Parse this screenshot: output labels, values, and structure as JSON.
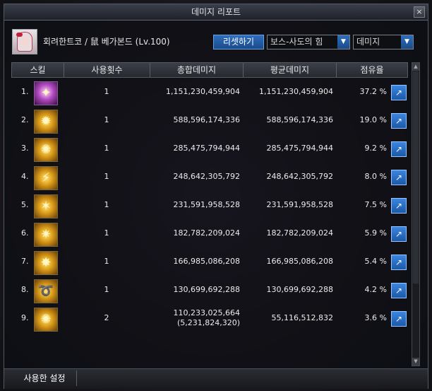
{
  "window": {
    "title": "데미지 리포트",
    "close_label": "×"
  },
  "character": {
    "info": "회려한트코 / 鼠 베가본드 (Lv.100)"
  },
  "toolbar": {
    "reset_label": "리셋하기",
    "dungeon_select": "보스-사도의 힘",
    "type_select": "데미지"
  },
  "table": {
    "headers": [
      "스킬",
      "사용횟수",
      "총합데미지",
      "평균데미지",
      "점유율"
    ],
    "rows": [
      {
        "index": "1.",
        "icon": "skill-icon-purple",
        "uses": "1",
        "total": "1,151,230,459,904",
        "avg": "1,151,230,459,904",
        "share": "37.2 %"
      },
      {
        "index": "2.",
        "icon": "skill-icon-gold",
        "uses": "1",
        "total": "588,596,174,336",
        "avg": "588,596,174,336",
        "share": "19.0 %"
      },
      {
        "index": "3.",
        "icon": "skill-icon-gold",
        "uses": "1",
        "total": "285,475,794,944",
        "avg": "285,475,794,944",
        "share": "9.2 %"
      },
      {
        "index": "4.",
        "icon": "skill-icon-gold",
        "uses": "1",
        "total": "248,642,305,792",
        "avg": "248,642,305,792",
        "share": "8.0 %"
      },
      {
        "index": "5.",
        "icon": "skill-icon-gold",
        "uses": "1",
        "total": "231,591,958,528",
        "avg": "231,591,958,528",
        "share": "7.5 %"
      },
      {
        "index": "6.",
        "icon": "skill-icon-gold",
        "uses": "1",
        "total": "182,782,209,024",
        "avg": "182,782,209,024",
        "share": "5.9 %"
      },
      {
        "index": "7.",
        "icon": "skill-icon-gold",
        "uses": "1",
        "total": "166,985,086,208",
        "avg": "166,985,086,208",
        "share": "5.4 %"
      },
      {
        "index": "8.",
        "icon": "skill-icon-gold",
        "uses": "1",
        "total": "130,699,692,288",
        "avg": "130,699,692,288",
        "share": "4.2 %"
      },
      {
        "index": "9.",
        "icon": "skill-icon-gold",
        "uses": "2",
        "total": "110,233,025,664",
        "total_sub": "(5,231,824,320)",
        "avg": "55,116,512,832",
        "share": "3.6 %"
      }
    ]
  },
  "footer": {
    "settings_label": "사용한 설정"
  }
}
